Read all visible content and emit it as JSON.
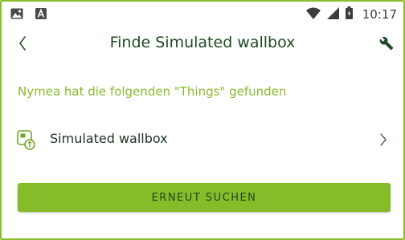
{
  "status_bar": {
    "time": "10:17",
    "left_icons": [
      "image-icon",
      "app-notification-icon"
    ],
    "right_icons": [
      "wifi-icon",
      "signal-icon",
      "battery-icon"
    ]
  },
  "header": {
    "title": "Finde Simulated wallbox",
    "back_icon": "chevron-left-icon",
    "settings_icon": "wrench-icon"
  },
  "content": {
    "subtitle": "Nymea hat die folgenden \"Things\" gefunden",
    "items": [
      {
        "label": "Simulated wallbox",
        "icon": "device-icon"
      }
    ]
  },
  "action": {
    "label": "ERNEUT SUCHEN"
  },
  "colors": {
    "accent": "#86bb2a",
    "title": "#1f4a23",
    "subtitle": "#88bb2e"
  }
}
